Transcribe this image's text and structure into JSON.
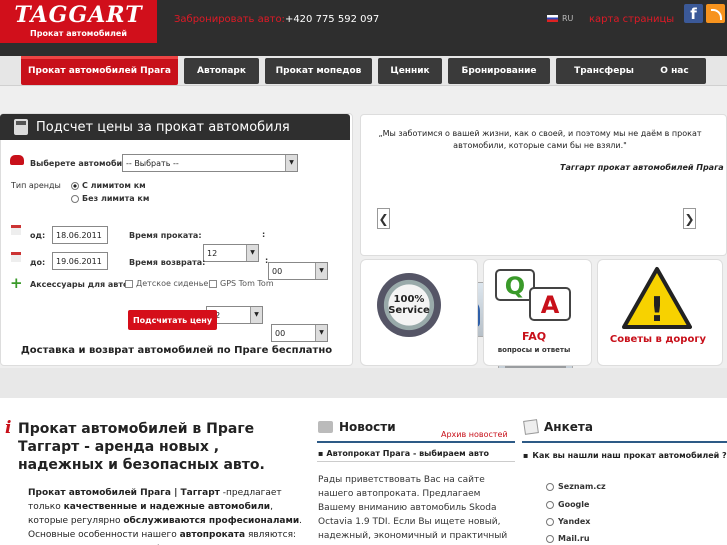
{
  "header": {
    "logo_text": "TAGGART",
    "logo_sub": "Прокат автомобилей",
    "book_label": "Забронировать авто:",
    "book_phone": "+420 775 592 097",
    "lang": "RU",
    "sitemap": "карта страницы",
    "facebook_icon": "f"
  },
  "nav": [
    {
      "label": "Прокат автомобилей Прага",
      "active": true
    },
    {
      "label": "Автопарк"
    },
    {
      "label": "Прокат мопедов"
    },
    {
      "label": "Ценник"
    },
    {
      "label": "Бронирование"
    },
    {
      "label": "Трансферы"
    },
    {
      "label": "О нас"
    }
  ],
  "calc": {
    "title": "Подсчет цены за прокат автомобиля",
    "car_label": "Выберете автомобиль:",
    "car_value": "-- Выбрать --",
    "type_label": "Тип аренды",
    "opt_limit": "С лимитом км",
    "opt_nolimit": "Без лимита км",
    "from_label": "од:",
    "from_date": "18.06.2011",
    "rent_time_label": "Время проката:",
    "rent_hour": "12",
    "rent_min": "00",
    "to_label": "до:",
    "to_date": "19.06.2011",
    "return_time_label": "Время возврата:",
    "return_hour": "12",
    "return_min": "00",
    "colon": ":",
    "acc_label": "Аксессуары для авто:",
    "acc_seat": "Детское сиденье",
    "acc_gps": "GPS Tom Tom",
    "button": "Подсчитать цену",
    "delivery": "Доставка и возврат автомобилей по Праге бесплатно"
  },
  "quote": {
    "text": "„Мы заботимся о вашей жизни, как о своей, и поэтому мы не даём в прокат автомобили, которые сами бы не взяли.\"",
    "author": "Таггарт прокат автомобилей Прага",
    "prev": "❮",
    "next": "❯"
  },
  "features": {
    "seal_big": "100%",
    "seal_small": "Service",
    "faq_q": "Q",
    "faq_a": "A",
    "faq_title": "FAQ",
    "faq_sub": "вопросы и ответы",
    "warning_mark": "!",
    "tips": "Советы в дорогу"
  },
  "intro": {
    "icon": "i",
    "heading": "Прокат автомобилей в Праге Таггарт - аренда новых , надежных и безопасных авто.",
    "p_b1": "Прокат  автомобилей Прага | Таггарт",
    "p_t1": " -предлагает только ",
    "p_b2": "качественные и надежные автомобили",
    "p_t2": ", которые регулярно ",
    "p_b3": "обслуживаются професионалами",
    "p_t3": ". Основные особенности нашего ",
    "p_b4": "автопроката",
    "p_t4": " являются: надежность, доверие, профессионализм и"
  },
  "news": {
    "heading": "Новости",
    "archive": "Архив новостей",
    "bullet": "▪",
    "item_title": "Автопрокат Прага - выбираем авто",
    "body": "Рады приветствовать Вас на сайте нашего автопроката. Предлагаем Вашему вниманию автомобиль Skoda Octavia 1.9 TDI. Если Вы ищете новый, надежный, экономичный и практичный автомобиль за разумные деньги, то Skoda Octavia тот самый вариант"
  },
  "poll": {
    "heading": "Анкета",
    "bullet": "▪",
    "question": "Как вы нашли наш прокат автомобилей ?",
    "options": [
      "Seznam.cz",
      "Google",
      "Yandex",
      "Mail.ru"
    ]
  }
}
